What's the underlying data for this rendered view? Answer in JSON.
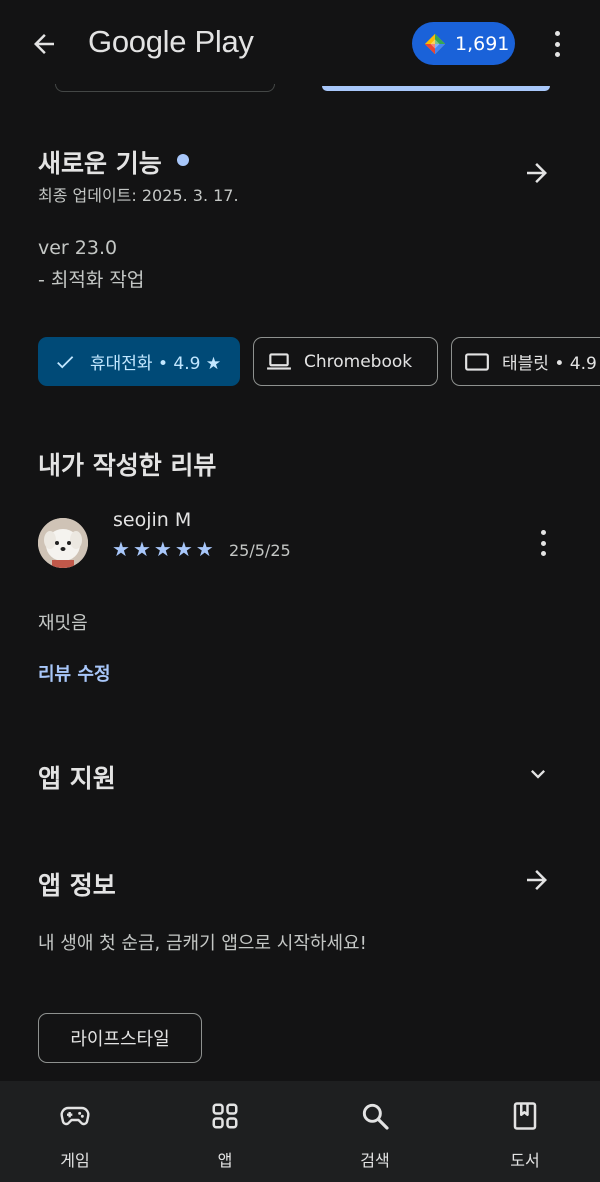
{
  "header": {
    "brand": "Google Play",
    "points": "1,691"
  },
  "whats_new": {
    "title": "새로운 기능",
    "updated": "최종 업데이트: 2025. 3. 17.",
    "notes": [
      "ver 23.0",
      "- 최적화 작업"
    ]
  },
  "device_chips": [
    {
      "label": "휴대전화 • 4.9 ★",
      "selected": true,
      "icon": "check-icon"
    },
    {
      "label": "Chromebook",
      "selected": false,
      "icon": "laptop-icon"
    },
    {
      "label": "태블릿 • 4.9",
      "selected": false,
      "icon": "tablet-icon"
    }
  ],
  "my_review": {
    "title": "내가 작성한 리뷰",
    "reviewer": "seojin M",
    "rating": 5,
    "date": "25/5/25",
    "text": "재밋음",
    "edit_label": "리뷰 수정"
  },
  "app_support": {
    "title": "앱 지원"
  },
  "app_info": {
    "title": "앱 정보",
    "description": "내 생애 첫 순금, 금캐기 앱으로 시작하세요!",
    "tag": "라이프스타일"
  },
  "bottom_nav": [
    {
      "label": "게임",
      "icon": "gamepad-icon"
    },
    {
      "label": "앱",
      "icon": "apps-grid-icon"
    },
    {
      "label": "검색",
      "icon": "search-icon"
    },
    {
      "label": "도서",
      "icon": "book-icon"
    }
  ],
  "colors": {
    "background": "#131314",
    "accent": "#a8c7fa",
    "points_badge": "#1a62d9",
    "selected_chip": "#004a77"
  }
}
